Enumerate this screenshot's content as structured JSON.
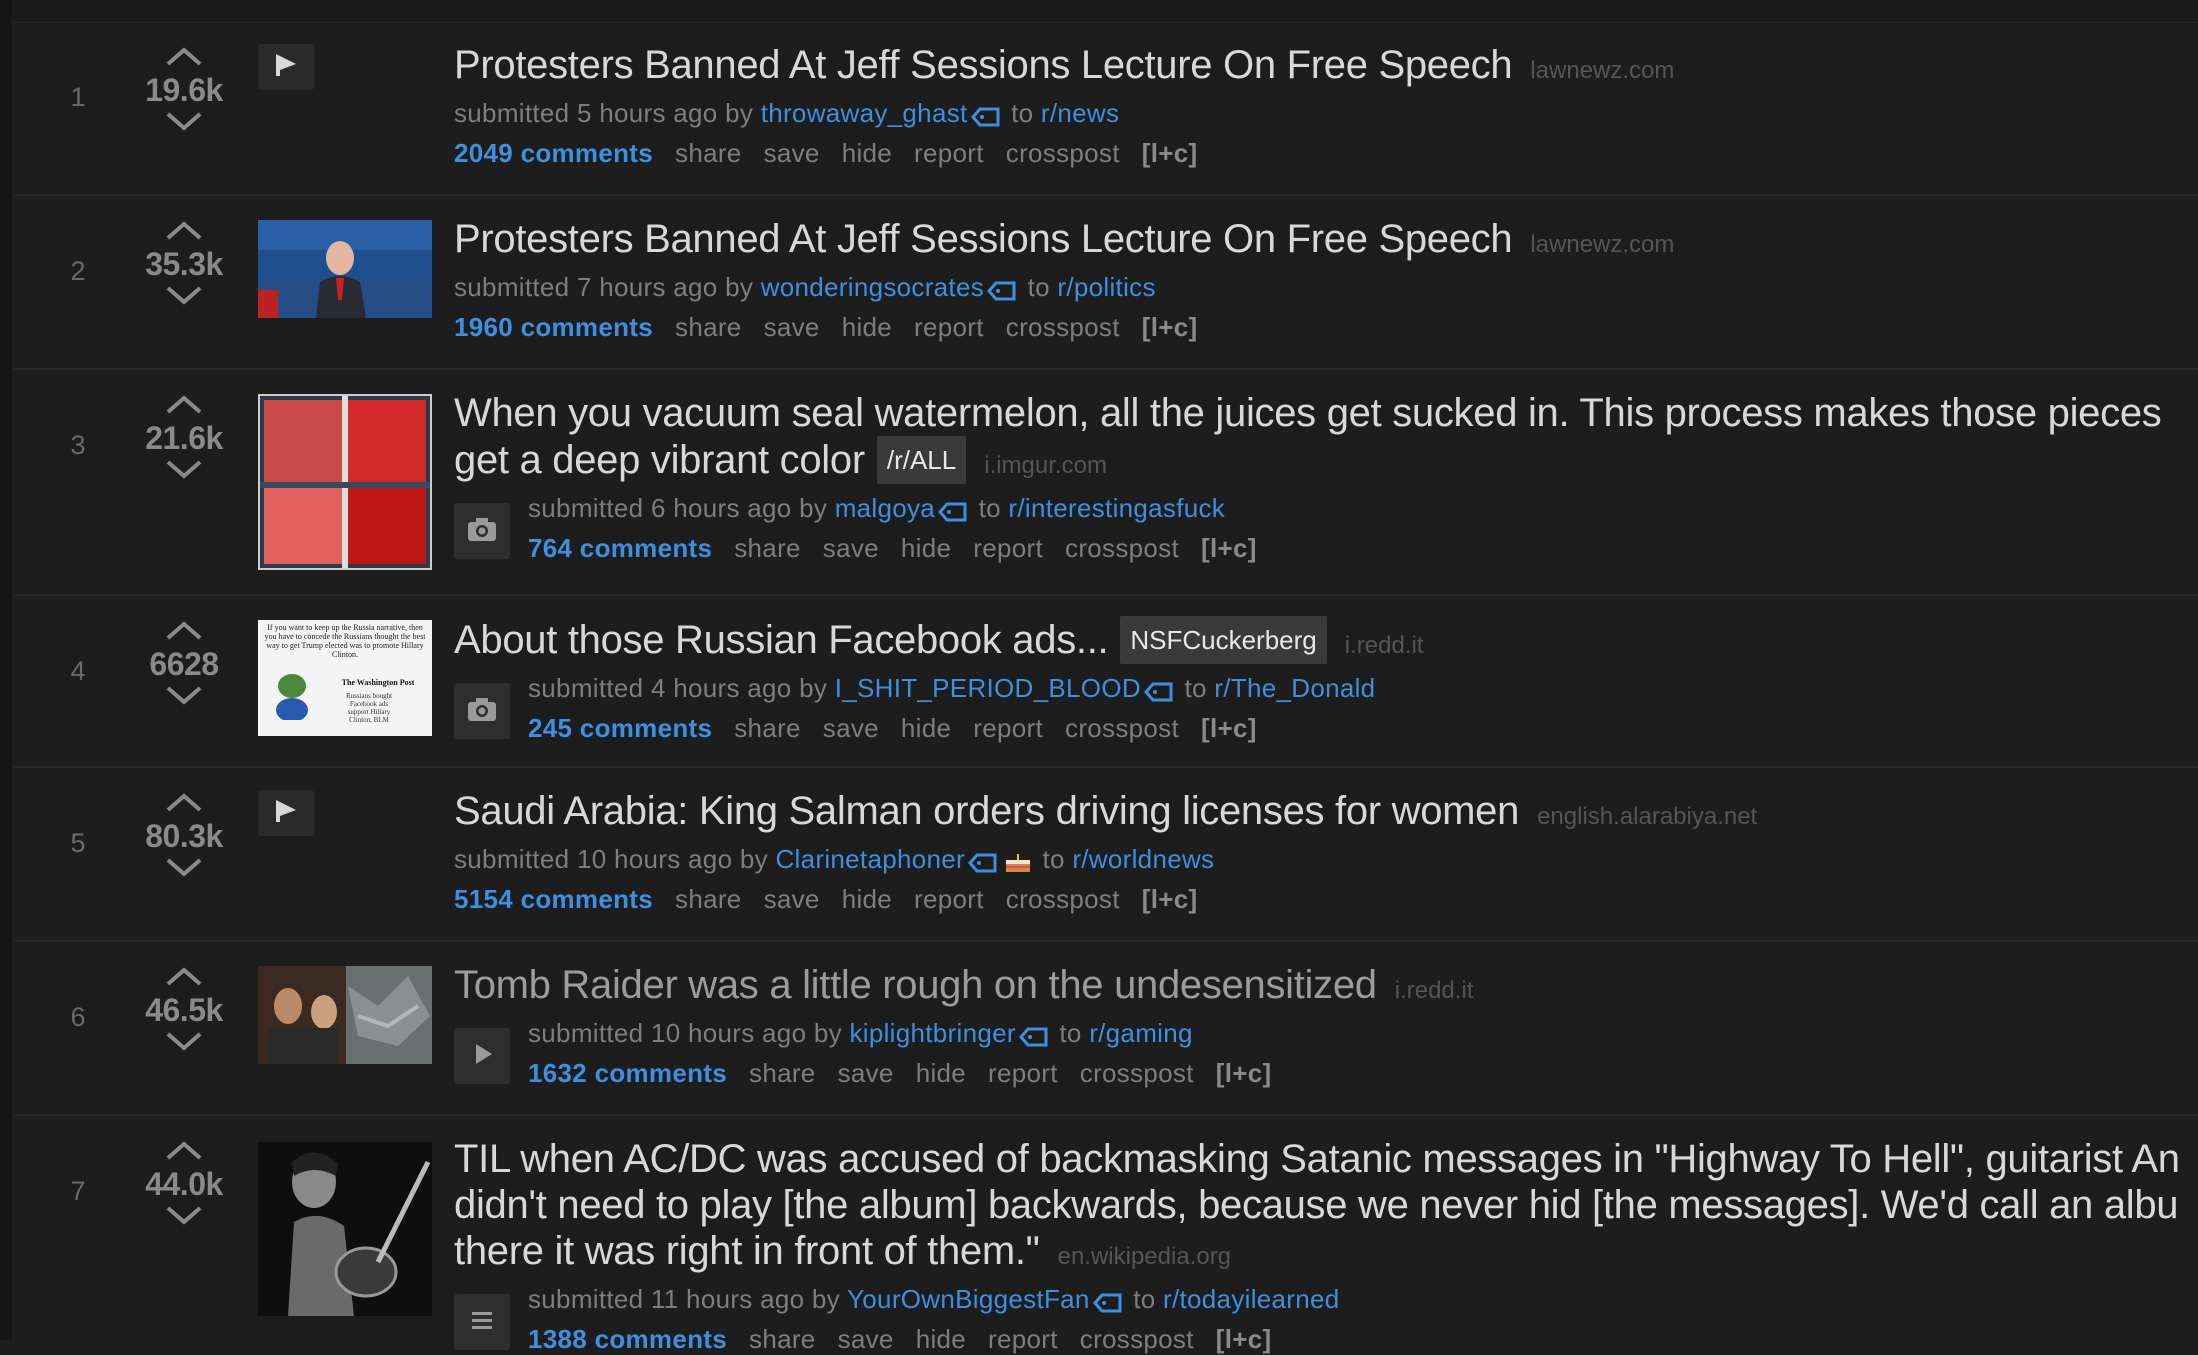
{
  "posts": [
    {
      "rank": "1",
      "score": "19.6k",
      "title": "Protesters Banned At Jeff Sessions Lecture On Free Speech",
      "flair": "",
      "domain": "lawnewz.com",
      "submitted": "submitted 5 hours ago by",
      "author": "throwaway_ghast",
      "to": "to",
      "subreddit": "r/news",
      "comments": "2049 comments",
      "thumb": "default"
    },
    {
      "rank": "2",
      "score": "35.3k",
      "title": "Protesters Banned At Jeff Sessions Lecture On Free Speech",
      "flair": "",
      "domain": "lawnewz.com",
      "submitted": "submitted 7 hours ago by",
      "author": "wonderingsocrates",
      "to": "to",
      "subreddit": "r/politics",
      "comments": "1960 comments",
      "thumb": "sessions"
    },
    {
      "rank": "3",
      "score": "21.6k",
      "title_line1": "When you vacuum seal watermelon, all the juices get sucked in. This process makes those pieces",
      "title_line2": "get a deep vibrant color",
      "flair": "/r/ALL",
      "domain": "i.imgur.com",
      "submitted": "submitted 6 hours ago by",
      "author": "malgoya",
      "to": "to",
      "subreddit": "r/interestingasfuck",
      "comments": "764 comments",
      "thumb": "watermelon",
      "expando": "camera-icon"
    },
    {
      "rank": "4",
      "score": "6628",
      "title": "About those Russian Facebook ads...",
      "flair": "NSFCuckerberg",
      "domain": "i.redd.it",
      "submitted": "submitted 4 hours ago by",
      "author": "I_SHIT_PERIOD_BLOOD",
      "to": "to",
      "subreddit": "r/The_Donald",
      "comments": "245 comments",
      "thumb": "newspaper",
      "expando": "camera-icon",
      "thumb_text": {
        "body": "If you want to keep up the Russia narrative, then you have to concede the Russians thought the best way to get Trump elected was to promote Hillary Clinton.",
        "masthead": "The Washington Post",
        "snippet": "Russians bought Facebook ads support Hillary Clinton, BLM"
      }
    },
    {
      "rank": "5",
      "score": "80.3k",
      "title": "Saudi Arabia: King Salman orders driving licenses for women",
      "flair": "",
      "domain": "english.alarabiya.net",
      "submitted": "submitted 10 hours ago by",
      "author": "Clarinetaphoner",
      "to": "to",
      "subreddit": "r/worldnews",
      "comments": "5154 comments",
      "thumb": "default",
      "cake": true
    },
    {
      "rank": "6",
      "score": "46.5k",
      "title": "Tomb Raider was a little rough on the undesensitized",
      "flair": "",
      "domain": "i.redd.it",
      "submitted": "submitted 10 hours ago by",
      "author": "kiplightbringer",
      "to": "to",
      "subreddit": "r/gaming",
      "comments": "1632 comments",
      "thumb": "tombraider",
      "expando": "play-icon",
      "visited": true
    },
    {
      "rank": "7",
      "score": "44.0k",
      "title_line1": "TIL when AC/DC was accused of backmasking Satanic messages in \"Highway To Hell\", guitarist An",
      "title_line2": "didn't need to play [the album] backwards, because we never hid [the messages]. We'd call an albu",
      "title_line3": "there it was right in front of them.\"",
      "flair": "",
      "domain": "en.wikipedia.org",
      "submitted": "submitted 11 hours ago by",
      "author": "YourOwnBiggestFan",
      "to": "to",
      "subreddit": "r/todayilearned",
      "comments": "1388 comments",
      "thumb": "guitarist",
      "expando": "text-icon"
    }
  ],
  "actions": {
    "share": "share",
    "save": "save",
    "hide": "hide",
    "report": "report",
    "crosspost": "crosspost",
    "expand": "[l+c]"
  },
  "colors": {
    "background": "#1d1d1d",
    "link": "#3d8fe0",
    "title": "#d8d8d8",
    "muted": "#7e7e7e"
  }
}
